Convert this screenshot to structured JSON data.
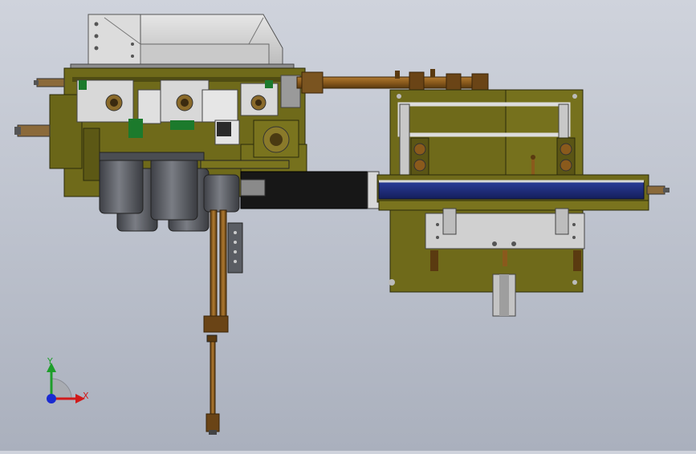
{
  "viewport": {
    "background_top": "#cfd3dc",
    "background_bottom": "#aab0bd",
    "model": {
      "frame_color": "#6f6a1a",
      "frame_dark": "#4f4c12",
      "sheet_metal_color": "#d4d4d4",
      "rod_color": "#8a5a1c",
      "belt_color": "#1f2f82",
      "cylinder_color": "#5a5d63",
      "accent_green": "#1c7a2c"
    }
  },
  "triad": {
    "y_label": "Y",
    "x_label": "X",
    "y_color": "#1e9e2a",
    "x_color": "#d11a1a",
    "z_color": "#1a2ad1"
  }
}
